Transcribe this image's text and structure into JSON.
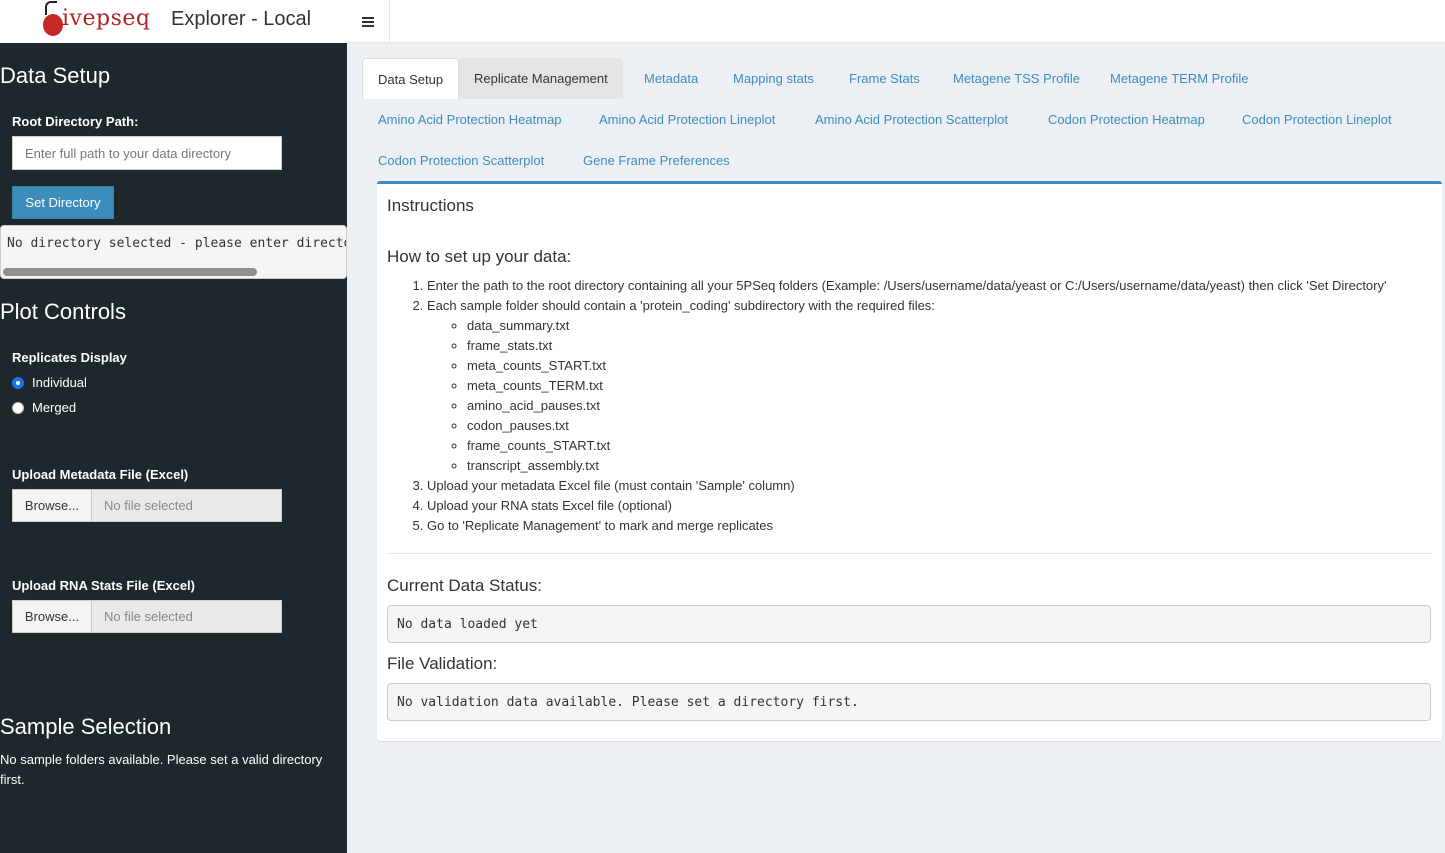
{
  "header": {
    "logo_text": "ivepseq",
    "app_title": "Explorer - Local",
    "toggle_icon": "hamburger-icon"
  },
  "sidebar": {
    "data_setup": {
      "heading": "Data Setup",
      "root_label": "Root Directory Path:",
      "root_placeholder": "Enter full path to your data directory",
      "root_value": "",
      "set_button": "Set Directory",
      "directory_status": "No directory selected - please enter directory path above"
    },
    "plot_controls": {
      "heading": "Plot Controls",
      "replicates_label": "Replicates Display",
      "options": [
        {
          "label": "Individual",
          "checked": true
        },
        {
          "label": "Merged",
          "checked": false
        }
      ],
      "metadata_upload": {
        "label": "Upload Metadata File (Excel)",
        "button": "Browse...",
        "placeholder": "No file selected"
      },
      "rna_upload": {
        "label": "Upload RNA Stats File (Excel)",
        "button": "Browse...",
        "placeholder": "No file selected"
      }
    },
    "sample_selection": {
      "heading": "Sample Selection",
      "note": "No sample folders available. Please set a valid directory first."
    }
  },
  "tabs": [
    {
      "label": "Data Setup",
      "state": "active"
    },
    {
      "label": "Replicate Management",
      "state": "hover"
    },
    {
      "label": "Metadata",
      "state": "normal"
    },
    {
      "label": "Mapping stats",
      "state": "normal"
    },
    {
      "label": "Frame Stats",
      "state": "normal"
    },
    {
      "label": "Metagene TSS Profile",
      "state": "normal"
    },
    {
      "label": "Metagene TERM Profile",
      "state": "normal"
    },
    {
      "label": "Amino Acid Protection Heatmap",
      "state": "normal"
    },
    {
      "label": "Amino Acid Protection Lineplot",
      "state": "normal"
    },
    {
      "label": "Amino Acid Protection Scatterplot",
      "state": "normal"
    },
    {
      "label": "Codon Protection Heatmap",
      "state": "normal"
    },
    {
      "label": "Codon Protection Lineplot",
      "state": "normal"
    },
    {
      "label": "Codon Protection Scatterplot",
      "state": "normal"
    },
    {
      "label": "Gene Frame Preferences",
      "state": "normal"
    }
  ],
  "instructions": {
    "title": "Instructions",
    "subtitle": "How to set up your data:",
    "steps": [
      "Enter the path to the root directory containing all your 5PSeq folders (Example: /Users/username/data/yeast or C:/Users/username/data/yeast) then click 'Set Directory'",
      "Each sample folder should contain a 'protein_coding' subdirectory with the required files:",
      "Upload your metadata Excel file (must contain 'Sample' column)",
      "Upload your RNA stats Excel file (optional)",
      "Go to 'Replicate Management' to mark and merge replicates"
    ],
    "required_files": [
      "data_summary.txt",
      "frame_stats.txt",
      "meta_counts_START.txt",
      "meta_counts_TERM.txt",
      "amino_acid_pauses.txt",
      "codon_pauses.txt",
      "frame_counts_START.txt",
      "transcript_assembly.txt"
    ],
    "data_status_heading": "Current Data Status:",
    "data_status": "No data loaded yet",
    "validation_heading": "File Validation:",
    "validation_status": "No validation data available. Please set a directory first."
  },
  "colors": {
    "sidebar_bg": "#1e282c",
    "accent": "#3c8dbc",
    "main_bg": "#ecf0f5"
  }
}
